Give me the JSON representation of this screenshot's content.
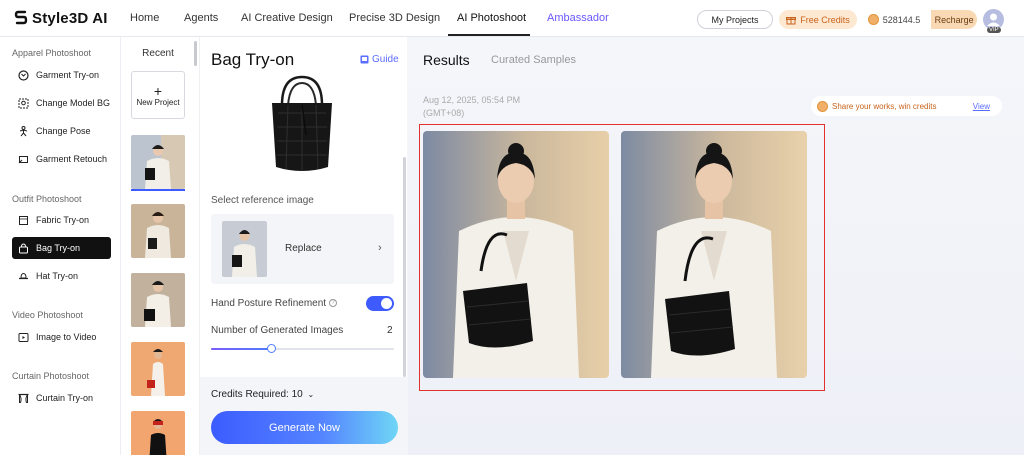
{
  "header": {
    "brand": "Style3D AI",
    "nav": [
      {
        "label": "Home"
      },
      {
        "label": "Agents"
      },
      {
        "label": "AI Creative Design"
      },
      {
        "label": "Precise 3D Design"
      },
      {
        "label": "AI Photoshoot"
      },
      {
        "label": "Ambassador"
      }
    ],
    "active_nav": "AI Photoshoot",
    "my_projects": "My Projects",
    "free_credits": "Free Credits",
    "credits_balance": "528144.5",
    "recharge": "Recharge",
    "badge": "VIP"
  },
  "sidebar": {
    "sections": [
      {
        "title": "Apparel Photoshoot",
        "items": [
          {
            "label": "Garment Try-on",
            "icon": "shirt-icon"
          },
          {
            "label": "Change Model BG",
            "icon": "background-swap-icon"
          },
          {
            "label": "Change Pose",
            "icon": "pose-icon"
          },
          {
            "label": "Garment Retouch",
            "icon": "retouch-icon"
          }
        ]
      },
      {
        "title": "Outfit Photoshoot",
        "items": [
          {
            "label": "Fabric Try-on",
            "icon": "fabric-icon"
          },
          {
            "label": "Bag Try-on",
            "icon": "bag-icon",
            "active": true
          },
          {
            "label": "Hat Try-on",
            "icon": "hat-icon"
          }
        ]
      },
      {
        "title": "Video Photoshoot",
        "items": [
          {
            "label": "Image to Video",
            "icon": "video-icon"
          }
        ]
      },
      {
        "title": "Curtain Photoshoot",
        "items": [
          {
            "label": "Curtain Try-on",
            "icon": "curtain-icon"
          }
        ]
      }
    ]
  },
  "recent": {
    "title": "Recent",
    "new_project": "New Project"
  },
  "config": {
    "title": "Bag Try-on",
    "guide": "Guide",
    "reference_label": "Select reference image",
    "replace": "Replace",
    "hand_posture": "Hand Posture Refinement",
    "hand_posture_enabled": true,
    "num_images_label": "Number of Generated Images",
    "num_images": "2",
    "num_images_fraction": 0.33,
    "credits_required": "Credits Required: 10",
    "generate": "Generate Now"
  },
  "results": {
    "tab_results": "Results",
    "tab_curated": "Curated Samples",
    "date": "Aug 12, 2025, 05:54 PM (GMT+08)",
    "share_text": "Share your works, win credits",
    "view": "View"
  },
  "colors": {
    "accent": "#3e5bff",
    "highlight_frame": "#e2322d",
    "ambassador": "#6a57ff"
  }
}
